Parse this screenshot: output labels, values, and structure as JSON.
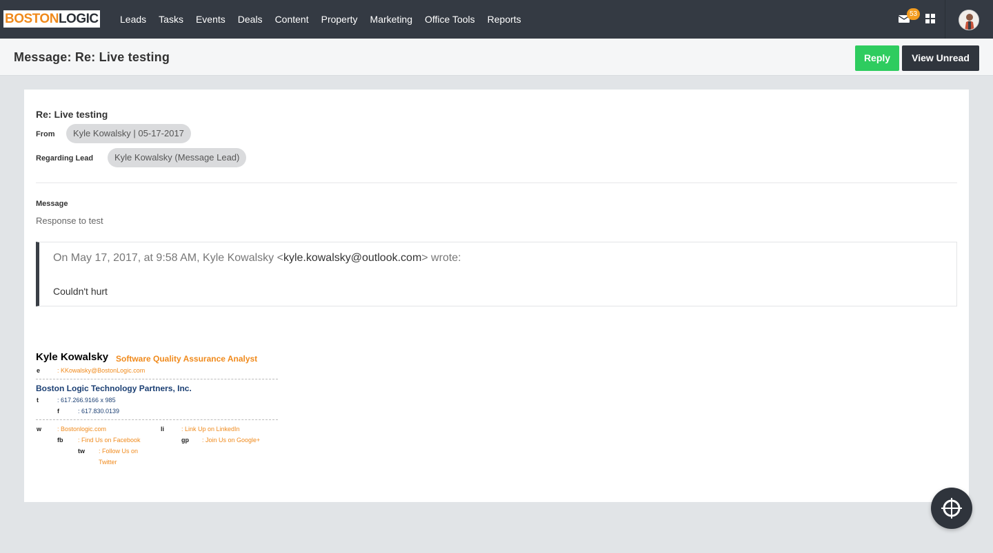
{
  "brand": {
    "logo_part1": "BOSTON",
    "logo_part2": "LOGIC"
  },
  "nav": {
    "items": [
      "Leads",
      "Tasks",
      "Events",
      "Deals",
      "Content",
      "Property",
      "Marketing",
      "Office Tools",
      "Reports"
    ],
    "notification_count": "53",
    "icons": [
      "envelope-icon",
      "apps-grid-icon",
      "user-avatar"
    ]
  },
  "header": {
    "title": "Message: Re: Live testing",
    "reply_label": "Reply",
    "view_unread_label": "View Unread"
  },
  "message": {
    "subject": "Re: Live testing",
    "from_label": "From",
    "from_value": "Kyle Kowalsky | 05-17-2017",
    "regarding_label": "Regarding Lead",
    "regarding_value": "Kyle Kowalsky (Message Lead)",
    "message_label": "Message",
    "body": "Response to test",
    "quote_prefix": "On May 17, 2017, at 9:58 AM, Kyle Kowalsky <",
    "quote_email": "kyle.kowalsky@outlook.com",
    "quote_suffix": "> wrote:",
    "quote_body": "Couldn't hurt"
  },
  "signature": {
    "name": "Kyle Kowalsky",
    "role": "Software Quality Assurance Analyst",
    "e_label": "e",
    "email": ": KKowalsky@BostonLogic.com",
    "company": "Boston Logic Technology Partners, Inc.",
    "t_label": "t",
    "phone": ": 617.266.9166 x 985",
    "f_label": "f",
    "fax": ": 617.830.0139",
    "w_label": "w",
    "website": ": Bostonlogic.com",
    "li_label": "li",
    "linkedin": ": Link Up on LinkedIn",
    "fb_label": "fb",
    "facebook": ": Find Us on Facebook",
    "gp_label": "gp",
    "googleplus": ": Join Us on Google+",
    "tw_label": "tw",
    "twitter_line1": ": Follow Us on",
    "twitter_line2": "Twitter"
  },
  "colors": {
    "nav_bg": "#343a43",
    "accent_orange": "#f08a1c",
    "reply_green": "#2ecc5f",
    "dark_button": "#30353d",
    "badge_orange": "#f39c1f"
  }
}
